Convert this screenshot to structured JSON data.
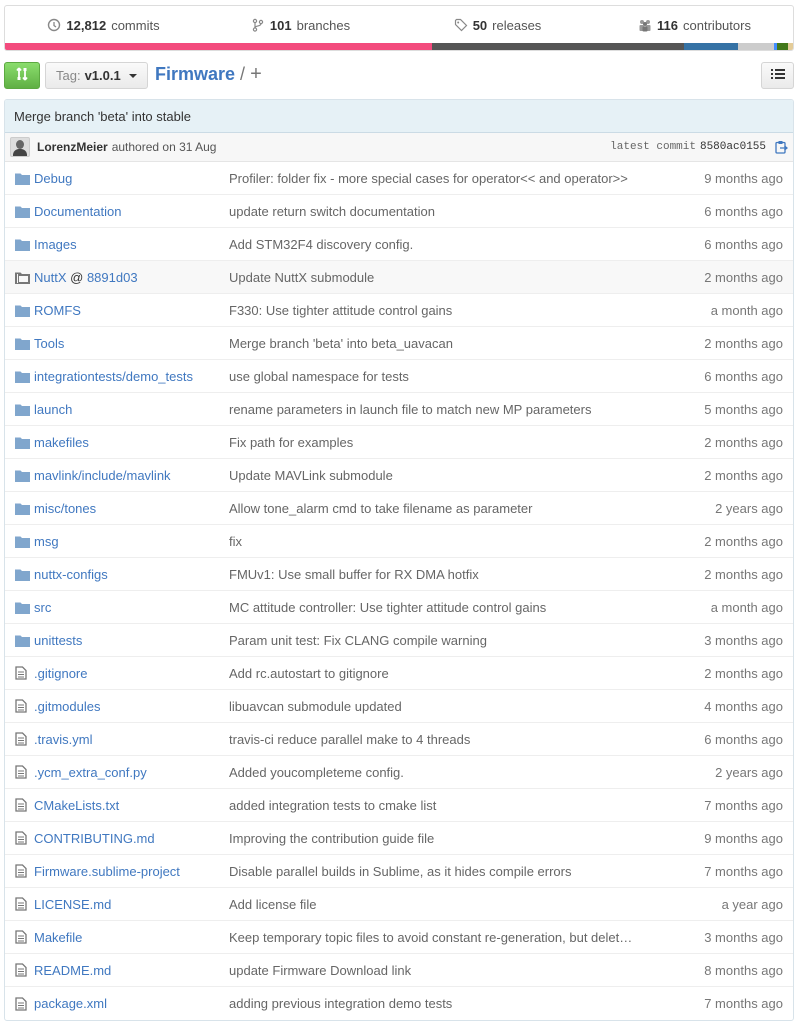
{
  "stats": {
    "commits": {
      "num": "12,812",
      "label": "commits"
    },
    "branches": {
      "num": "101",
      "label": "branches"
    },
    "releases": {
      "num": "50",
      "label": "releases"
    },
    "contributors": {
      "num": "116",
      "label": "contributors"
    }
  },
  "language_bar": [
    {
      "color": "#f34b7d",
      "fraction": 0.542
    },
    {
      "color": "#555555",
      "fraction": 0.32
    },
    {
      "color": "#3572a5",
      "fraction": 0.068
    },
    {
      "color": "#cccccc",
      "fraction": 0.046
    },
    {
      "color": "#438eff",
      "fraction": 0.004
    },
    {
      "color": "#427819",
      "fraction": 0.014
    },
    {
      "color": "#e4cc98",
      "fraction": 0.006
    }
  ],
  "toolbar": {
    "tag_label": "Tag:",
    "tag_value": "v1.0.1",
    "repo": "Firmware",
    "sep": "/",
    "plus": "+"
  },
  "commit": {
    "message": "Merge branch 'beta' into stable",
    "author": "LorenzMeier",
    "authored": "authored on 31 Aug",
    "latest_label": "latest commit",
    "sha": "8580ac0155"
  },
  "files": [
    {
      "type": "dir",
      "name": "Debug",
      "msg": "Profiler: folder fix - more special cases for operator<< and operator>>",
      "age": "9 months ago"
    },
    {
      "type": "dir",
      "name": "Documentation",
      "msg": "update return switch documentation",
      "age": "6 months ago"
    },
    {
      "type": "dir",
      "name": "Images",
      "msg": "Add STM32F4 discovery config.",
      "age": "6 months ago"
    },
    {
      "type": "submodule",
      "name": "NuttX",
      "at": " @ ",
      "ref": "8891d03",
      "msg": "Update NuttX submodule",
      "age": "2 months ago"
    },
    {
      "type": "dir",
      "name": "ROMFS",
      "msg": "F330: Use tighter attitude control gains",
      "age": "a month ago"
    },
    {
      "type": "dir",
      "name": "Tools",
      "msg": "Merge branch 'beta' into beta_uavacan",
      "age": "2 months ago"
    },
    {
      "type": "dir",
      "name": "integrationtests/demo_tests",
      "msg": "use global namespace for tests",
      "age": "6 months ago"
    },
    {
      "type": "dir",
      "name": "launch",
      "msg": "rename parameters in launch file to match new MP parameters",
      "age": "5 months ago"
    },
    {
      "type": "dir",
      "name": "makefiles",
      "msg": "Fix path for examples",
      "age": "2 months ago"
    },
    {
      "type": "dir",
      "name": "mavlink/include/mavlink",
      "msg": "Update MAVLink submodule",
      "age": "2 months ago"
    },
    {
      "type": "dir",
      "name": "misc/tones",
      "msg": "Allow tone_alarm cmd to take filename as parameter",
      "age": "2 years ago"
    },
    {
      "type": "dir",
      "name": "msg",
      "msg": "fix",
      "age": "2 months ago"
    },
    {
      "type": "dir",
      "name": "nuttx-configs",
      "msg": "FMUv1: Use small buffer for RX DMA hotfix",
      "age": "2 months ago"
    },
    {
      "type": "dir",
      "name": "src",
      "msg": "MC attitude controller: Use tighter attitude control gains",
      "age": "a month ago"
    },
    {
      "type": "dir",
      "name": "unittests",
      "msg": "Param unit test: Fix CLANG compile warning",
      "age": "3 months ago"
    },
    {
      "type": "file",
      "name": ".gitignore",
      "msg": "Add rc.autostart to gitignore",
      "age": "2 months ago"
    },
    {
      "type": "file",
      "name": ".gitmodules",
      "msg": "libuavcan submodule updated",
      "age": "4 months ago"
    },
    {
      "type": "file",
      "name": ".travis.yml",
      "msg": "travis-ci reduce parallel make to 4 threads",
      "age": "6 months ago"
    },
    {
      "type": "file",
      "name": ".ycm_extra_conf.py",
      "msg": "Added youcompleteme config.",
      "age": "2 years ago"
    },
    {
      "type": "file",
      "name": "CMakeLists.txt",
      "msg": "added integration tests to cmake list",
      "age": "7 months ago"
    },
    {
      "type": "file",
      "name": "CONTRIBUTING.md",
      "msg": "Improving the contribution guide file",
      "age": "9 months ago"
    },
    {
      "type": "file",
      "name": "Firmware.sublime-project",
      "msg": "Disable parallel builds in Sublime, as it hides compile errors",
      "age": "7 months ago"
    },
    {
      "type": "file",
      "name": "LICENSE.md",
      "msg": "Add license file",
      "age": "a year ago"
    },
    {
      "type": "file",
      "name": "Makefile",
      "msg": "Keep temporary topic files to avoid constant re-generation, but delet…",
      "age": "3 months ago"
    },
    {
      "type": "file",
      "name": "README.md",
      "msg": "update Firmware Download link",
      "age": "8 months ago"
    },
    {
      "type": "file",
      "name": "package.xml",
      "msg": "adding previous integration demo tests",
      "age": "7 months ago"
    }
  ]
}
